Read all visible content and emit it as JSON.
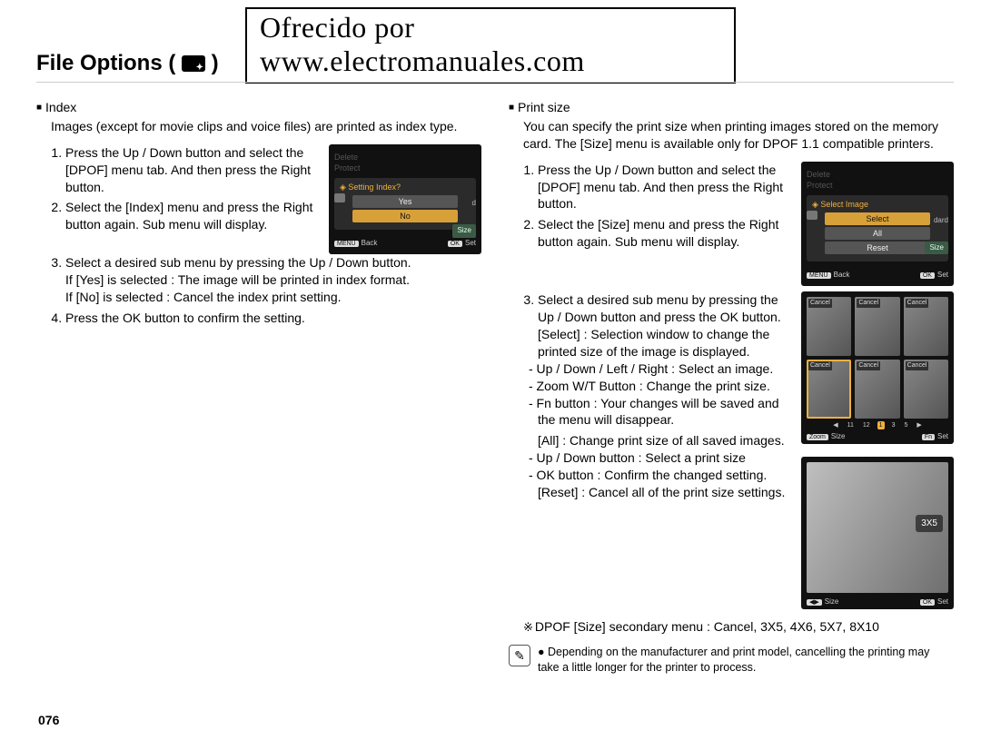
{
  "watermark": "Ofrecido por www.electromanuales.com",
  "page_number": "076",
  "title": "File Options (",
  "title_close": ")",
  "left": {
    "heading": "Index",
    "intro": "Images (except for movie clips and voice files) are printed as index type.",
    "steps": [
      "Press the Up / Down button and select the [DPOF] menu tab. And then press the Right button.",
      "Select the [Index] menu and press the Right button again. Sub menu will display.",
      "Select a desired sub menu by pressing the Up / Down button.",
      "Press the OK button to confirm the setting."
    ],
    "step3_lines": [
      "If [Yes] is selected : The image will be printed in index format.",
      "If [No] is selected   : Cancel the index print setting."
    ],
    "lcd": {
      "menu_dim1": "Delete",
      "menu_dim2": "Protect",
      "question": "Setting Index?",
      "opt_yes": "Yes",
      "opt_no": "No",
      "side_word": "d",
      "side_tag": "Size",
      "back_key": "MENU",
      "back_label": "Back",
      "set_key": "OK",
      "set_label": "Set"
    }
  },
  "right": {
    "heading": "Print size",
    "intro": "You can specify the print size when printing images stored on the memory card. The [Size] menu is available only for DPOF 1.1 compatible printers.",
    "steps12": [
      "Press the Up / Down button and select the [DPOF] menu tab. And then press the Right button.",
      "Select the [Size] menu and press the Right button again. Sub menu will display."
    ],
    "step3_intro": "Select a desired sub menu by pressing the Up / Down button and press the OK button.",
    "select_label": "[Select] : Selection window to change the printed size of the image is displayed.",
    "select_bullets": [
      "- Up / Down / Left / Right : Select an image.",
      "- Zoom W/T Button : Change the print size.",
      "- Fn button : Your changes will be saved and the menu will disappear."
    ],
    "all_label": "[All] : Change print size of all saved images.",
    "all_bullets": [
      "- Up / Down button : Select a print size",
      "- OK button : Confirm the changed setting."
    ],
    "reset_label": "[Reset] : Cancel all of the print size settings.",
    "secondary": "DPOF [Size] secondary menu : Cancel, 3X5, 4X6, 5X7, 8X10",
    "note": "Depending on the manufacturer and print model, cancelling the printing may take a little longer for the printer to process.",
    "lcd1": {
      "menu_dim1": "Delete",
      "menu_dim2": "Protect",
      "question": "Select Image",
      "opt_select": "Select",
      "opt_all": "All",
      "opt_reset": "Reset",
      "side_word": "dard",
      "side_tag": "Size",
      "back_key": "MENU",
      "back_label": "Back",
      "set_key": "OK",
      "set_label": "Set"
    },
    "lcd2": {
      "tag": "Cancel",
      "strip": [
        "◀",
        "11",
        "12",
        "1",
        "3",
        "5",
        "▶"
      ],
      "left_key": "Zoom",
      "left_label": "Size",
      "right_key": "Fn",
      "right_label": "Set"
    },
    "lcd3": {
      "badge": "3X5",
      "left_key": "◀▶",
      "left_label": "Size",
      "right_key": "OK",
      "right_label": "Set"
    }
  }
}
